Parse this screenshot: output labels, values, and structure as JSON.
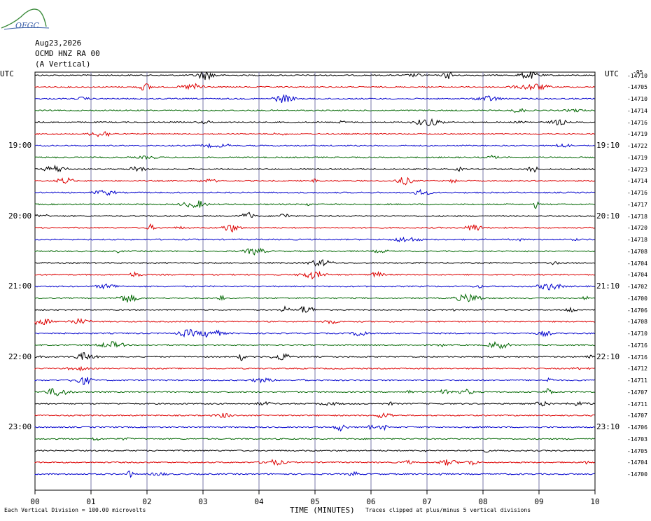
{
  "logo": {
    "text": "OFGC",
    "icon": "ofgc-logo-icon"
  },
  "header": {
    "date": "Aug23,2026",
    "station": "OCMD HNZ RA 00",
    "component": "(A Vertical)"
  },
  "left_axis_label": "UTC",
  "right_axis_label": "UTC",
  "top_right_code": "-95",
  "chart_data": {
    "type": "line",
    "title": "",
    "xlabel": "TIME (MINUTES)",
    "x_ticks": [
      "00",
      "01",
      "02",
      "03",
      "04",
      "05",
      "06",
      "07",
      "08",
      "09",
      "10"
    ],
    "xlim": [
      0,
      10
    ],
    "grid": true,
    "trace_colors": [
      "#000000",
      "#dd0000",
      "#0000cc",
      "#006600"
    ],
    "left_time_labels": [
      {
        "row": 6,
        "label": "19:00"
      },
      {
        "row": 12,
        "label": "20:00"
      },
      {
        "row": 18,
        "label": "21:00"
      },
      {
        "row": 24,
        "label": "22:00"
      },
      {
        "row": 30,
        "label": "23:00"
      }
    ],
    "right_time_labels": [
      {
        "row": 6,
        "label": "19:10"
      },
      {
        "row": 12,
        "label": "20:10"
      },
      {
        "row": 18,
        "label": "21:10"
      },
      {
        "row": 24,
        "label": "22:10"
      },
      {
        "row": 30,
        "label": "23:10"
      }
    ],
    "trace_offsets": [
      -14710,
      -14705,
      -14710,
      -14714,
      -14716,
      -14719,
      -14722,
      -14719,
      -14723,
      -14714,
      -14716,
      -14717,
      -14718,
      -14720,
      -14718,
      -14708,
      -14704,
      -14704,
      -14702,
      -14700,
      -14706,
      -14708,
      -14710,
      -14716,
      -14716,
      -14712,
      -14711,
      -14707,
      -14711,
      -14707,
      -14706,
      -14703,
      -14705,
      -14704,
      -14700
    ],
    "vertical_division": "Each Vertical Division = 100.00 microvolts",
    "clip_note": "Traces clipped at plus/minus 5 vertical divisions"
  }
}
